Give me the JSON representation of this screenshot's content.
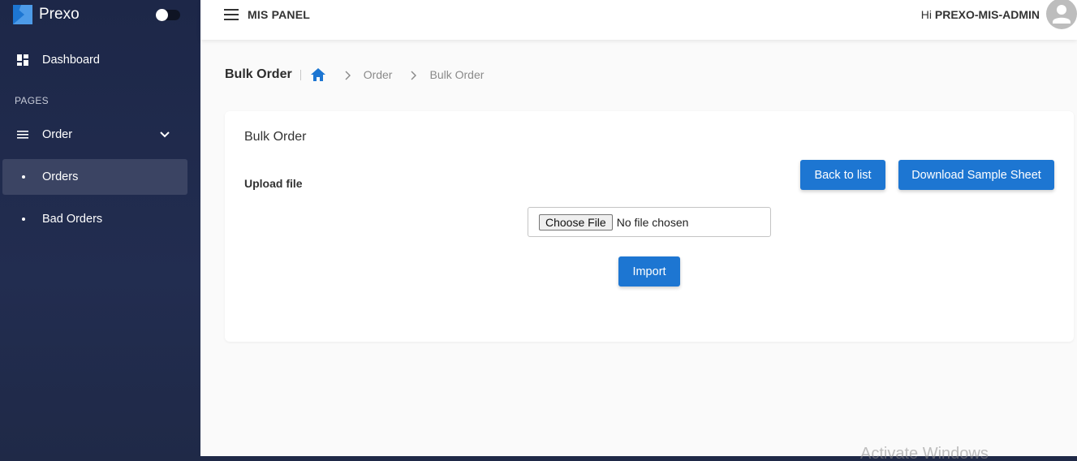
{
  "brand": {
    "name": "Prexo",
    "logo_icon": "prexo-logo-icon",
    "accent": "#1d76d2"
  },
  "theme_toggle": {
    "state": "off"
  },
  "sidebar": {
    "dashboard_label": "Dashboard",
    "section_label": "PAGES",
    "order_label": "Order",
    "sub_items": [
      {
        "label": "Orders",
        "active": true
      },
      {
        "label": "Bad Orders",
        "active": false
      }
    ],
    "bg_color": "#1d2748",
    "active_color": "#3b4463"
  },
  "topbar": {
    "panel_title": "MIS PANEL",
    "greeting_prefix": "Hi",
    "user_name": "PREXO-MIS-ADMIN"
  },
  "breadcrumb": {
    "title": "Bulk Order",
    "links": [
      "Order"
    ],
    "current": "Bulk Order"
  },
  "card": {
    "title": "Bulk Order",
    "upload_label": "Upload file",
    "back_button": "Back to list",
    "download_button": "Download Sample Sheet",
    "file_button": "Choose File",
    "file_status": "No file chosen",
    "import_button": "Import"
  },
  "watermark": "Activate Windows"
}
